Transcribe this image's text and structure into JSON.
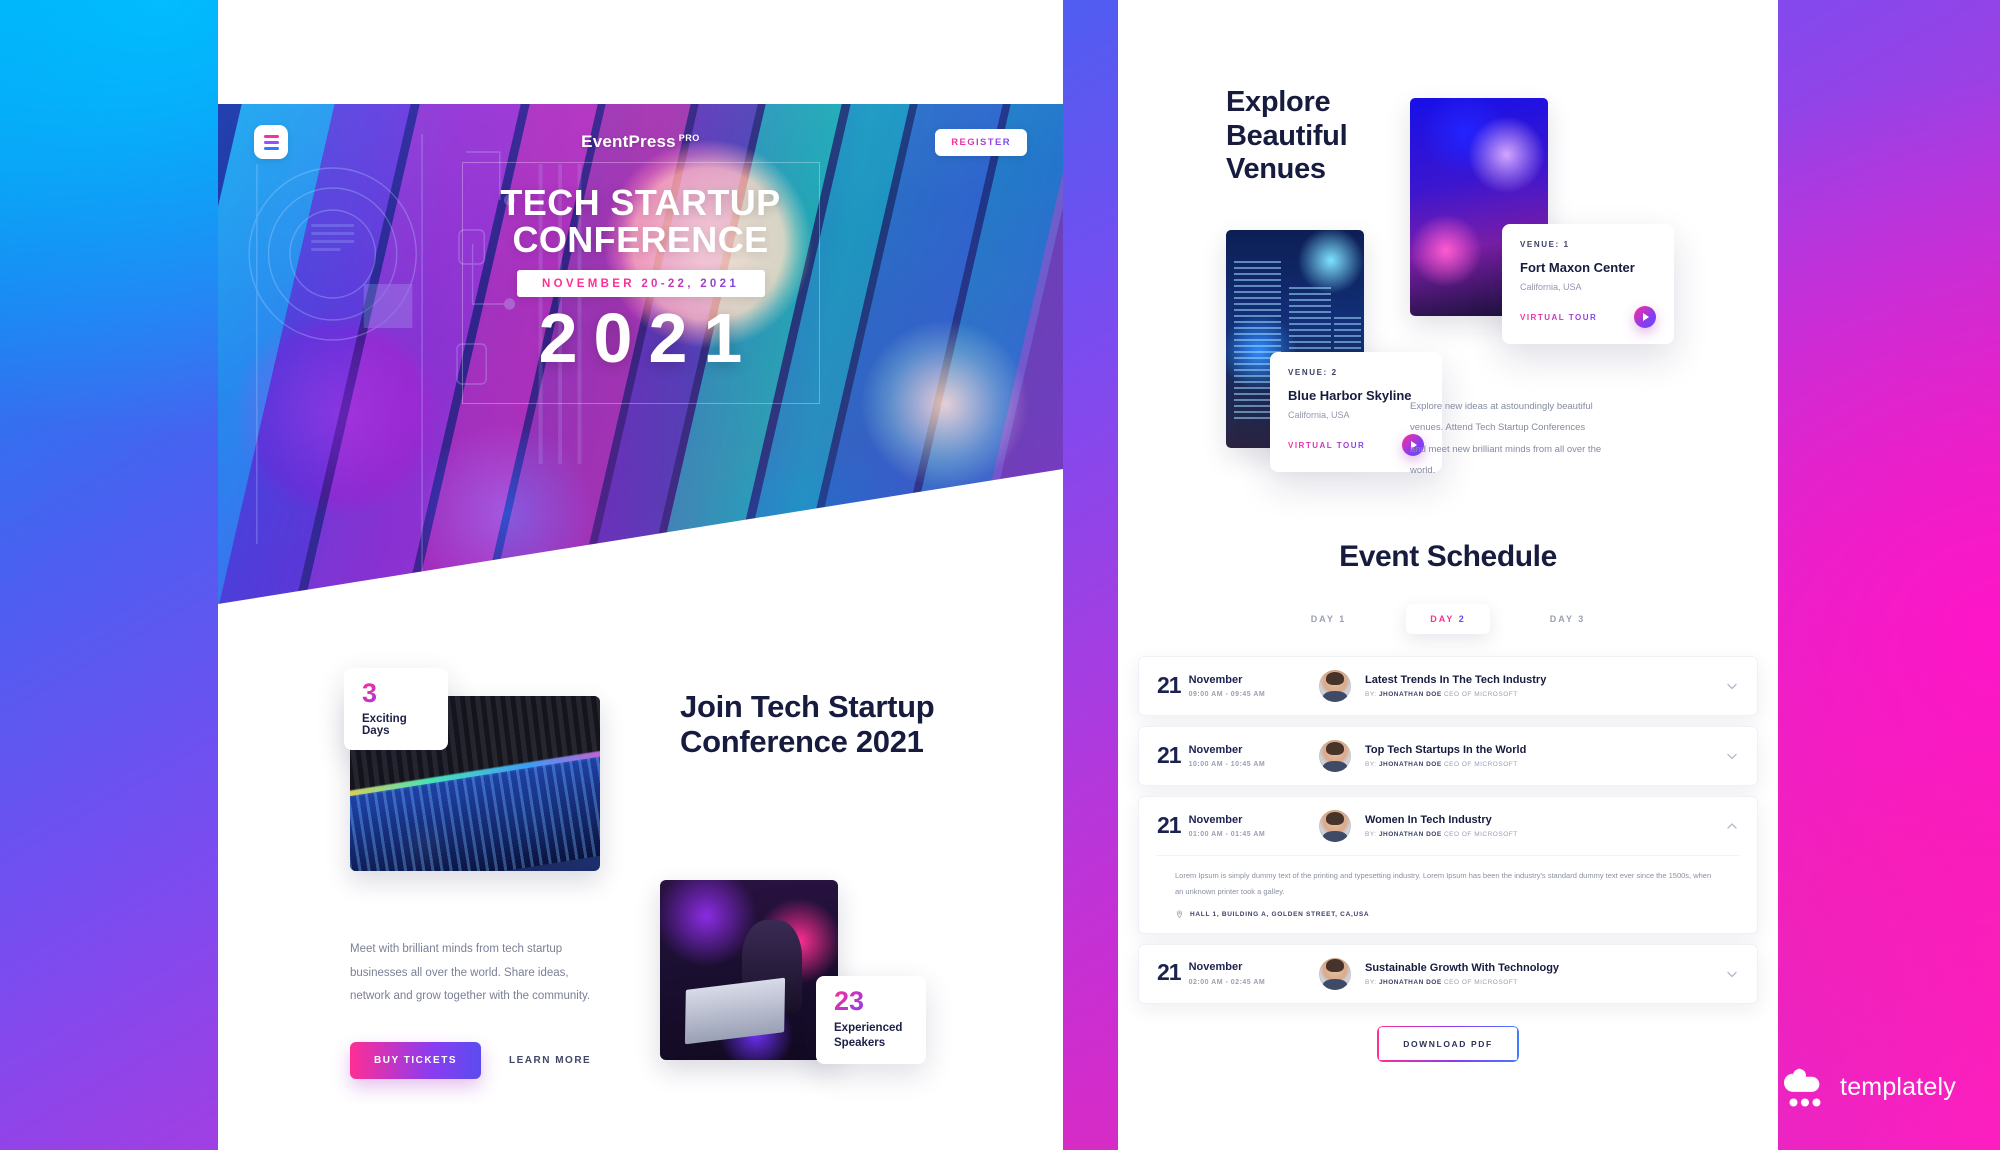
{
  "hero": {
    "menu_icon": "hamburger-menu-icon",
    "brand": "EventPress",
    "brand_sup": "PRO",
    "register_label": "REGISTER",
    "title_line1": "TECH STARTUP",
    "title_line2": "CONFERENCE",
    "date": "NOVEMBER 20-22, 2021",
    "year": "2021"
  },
  "join": {
    "heading": "Join Tech Startup Conference 2021",
    "paragraph": "Meet with brilliant minds from tech startup businesses all over the world. Share ideas, network and grow together with the community.",
    "buy_label": "BUY TICKETS",
    "learn_label": "LEARN MORE",
    "stat_days": {
      "number": "3",
      "label": "Exciting Days"
    },
    "stat_speakers": {
      "number": "23",
      "label": "Experienced Speakers"
    }
  },
  "venues": {
    "heading_line1": "Explore",
    "heading_line2": "Beautiful",
    "heading_line3": "Venues",
    "paragraph": "Explore new ideas at astoundingly beautiful venues. Attend Tech Startup Conferences and meet new brilliant minds from all over the world.",
    "cards": [
      {
        "no": "VENUE: 1",
        "name": "Fort Maxon Center",
        "location": "California, USA",
        "tour_label": "VIRTUAL TOUR",
        "play_icon": "play-icon"
      },
      {
        "no": "VENUE: 2",
        "name": "Blue Harbor Skyline",
        "location": "California, USA",
        "tour_label": "VIRTUAL TOUR",
        "play_icon": "play-icon"
      }
    ]
  },
  "schedule": {
    "title": "Event Schedule",
    "tabs": [
      {
        "label": "DAY 1",
        "active": false
      },
      {
        "label_a": "DAY",
        "label_b": "2",
        "active": true
      },
      {
        "label": "DAY 3",
        "active": false
      }
    ],
    "items": [
      {
        "day": "21",
        "month": "November",
        "time": "09:00 AM - 09:45 AM",
        "title": "Latest Trends In The Tech Industry",
        "by_prefix": "BY:",
        "by_name": "JHONATHAN DOE",
        "by_role": "CEO OF MICROSOFT",
        "expanded": false,
        "chevron": "chevron-down-icon"
      },
      {
        "day": "21",
        "month": "November",
        "time": "10:00 AM - 10:45 AM",
        "title": "Top Tech Startups In the World",
        "by_prefix": "BY:",
        "by_name": "JHONATHAN DOE",
        "by_role": "CEO OF MICROSOFT",
        "expanded": false,
        "chevron": "chevron-down-icon"
      },
      {
        "day": "21",
        "month": "November",
        "time": "01:00 AM - 01:45 AM",
        "title": "Women In Tech Industry",
        "by_prefix": "BY:",
        "by_name": "JHONATHAN DOE",
        "by_role": "CEO OF MICROSOFT",
        "expanded": true,
        "chevron": "chevron-up-icon",
        "description": "Lorem Ipsum is simply dummy text of the printing and typesetting industry. Lorem Ipsum has been the industry's standard dummy text ever since the 1500s, when an unknown printer took a galley.",
        "location": "HALL 1, BUILDING A, GOLDEN STREET, CA,USA",
        "location_icon": "map-pin-icon"
      },
      {
        "day": "21",
        "month": "November",
        "time": "02:00 AM - 02:45 AM",
        "title": "Sustainable Growth With Technology",
        "by_prefix": "BY:",
        "by_name": "JHONATHAN DOE",
        "by_role": "CEO OF MICROSOFT",
        "expanded": false,
        "chevron": "chevron-down-icon"
      }
    ],
    "download_label": "DOWNLOAD PDF"
  },
  "watermark": {
    "name": "templately",
    "icon": "templately-cloud-icon"
  },
  "colors": {
    "pink": "#ff2e93",
    "purple": "#8b3cf0",
    "blue": "#5b4cf0",
    "ink": "#171c3f",
    "muted": "#9aa0b4"
  }
}
